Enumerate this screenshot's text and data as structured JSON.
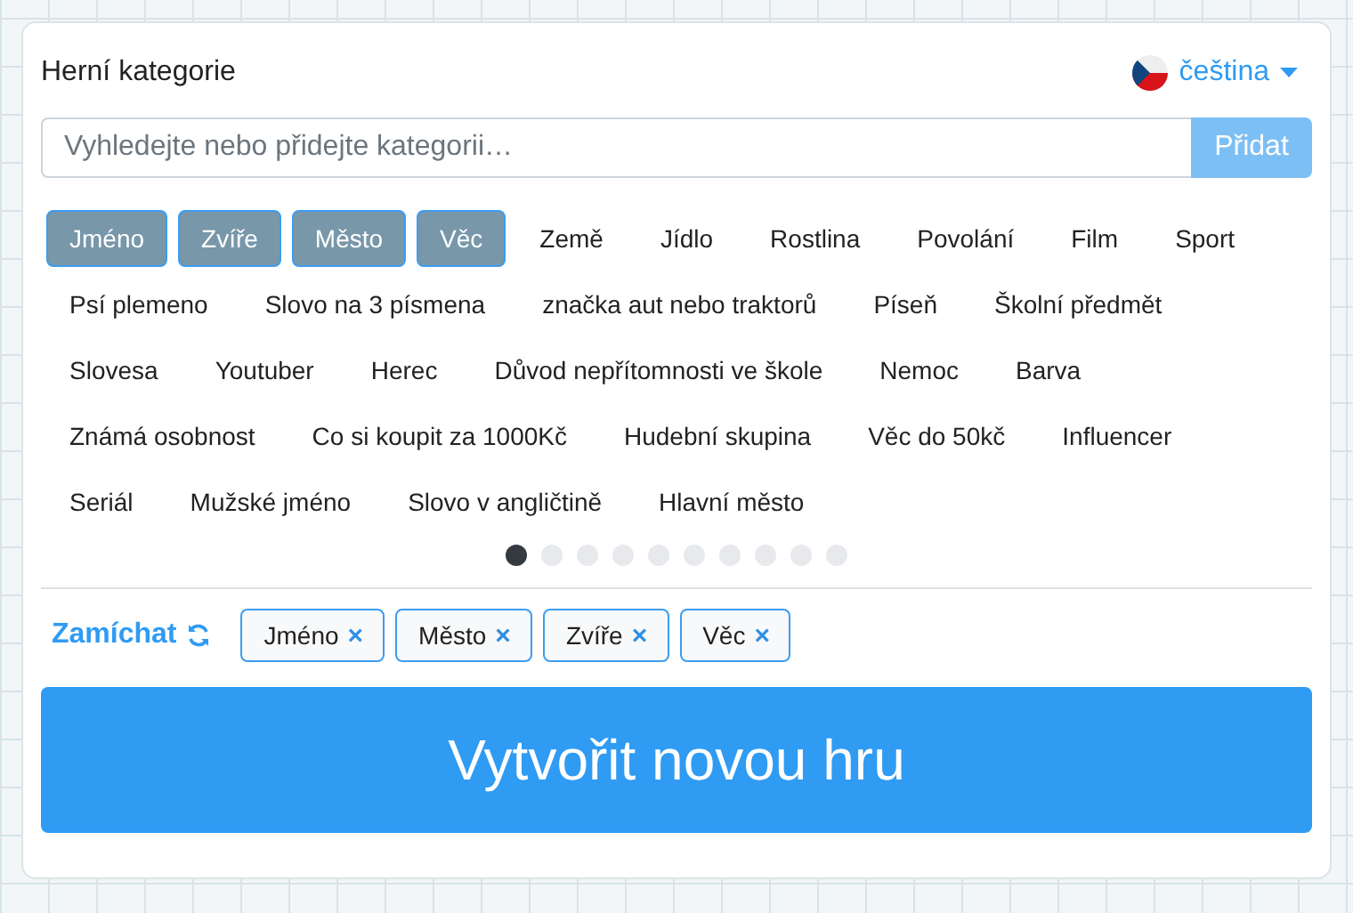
{
  "header": {
    "title": "Herní kategorie",
    "language": "čeština"
  },
  "search": {
    "placeholder": "Vyhledejte nebo přidejte kategorii…",
    "button": "Přidat"
  },
  "categories": [
    {
      "label": "Jméno",
      "selected": true
    },
    {
      "label": "Zvíře",
      "selected": true
    },
    {
      "label": "Město",
      "selected": true
    },
    {
      "label": "Věc",
      "selected": true
    },
    {
      "label": "Země",
      "selected": false
    },
    {
      "label": "Jídlo",
      "selected": false
    },
    {
      "label": "Rostlina",
      "selected": false
    },
    {
      "label": "Povolání",
      "selected": false
    },
    {
      "label": "Film",
      "selected": false
    },
    {
      "label": "Sport",
      "selected": false
    },
    {
      "label": "Psí plemeno",
      "selected": false
    },
    {
      "label": "Slovo na 3 písmena",
      "selected": false
    },
    {
      "label": "značka aut nebo traktorů",
      "selected": false
    },
    {
      "label": "Píseň",
      "selected": false
    },
    {
      "label": "Školní předmět",
      "selected": false
    },
    {
      "label": "Slovesa",
      "selected": false
    },
    {
      "label": "Youtuber",
      "selected": false
    },
    {
      "label": "Herec",
      "selected": false
    },
    {
      "label": "Důvod nepřítomnosti ve škole",
      "selected": false
    },
    {
      "label": "Nemoc",
      "selected": false
    },
    {
      "label": "Barva",
      "selected": false
    },
    {
      "label": "Známá osobnost",
      "selected": false
    },
    {
      "label": "Co si koupit za 1000Kč",
      "selected": false
    },
    {
      "label": "Hudební skupina",
      "selected": false
    },
    {
      "label": "Věc do 50kč",
      "selected": false
    },
    {
      "label": "Influencer",
      "selected": false
    },
    {
      "label": "Seriál",
      "selected": false
    },
    {
      "label": "Mužské jméno",
      "selected": false
    },
    {
      "label": "Slovo v angličtině",
      "selected": false
    },
    {
      "label": "Hlavní město",
      "selected": false
    }
  ],
  "pages": [
    {
      "selected": true
    },
    {
      "selected": false
    },
    {
      "selected": false
    },
    {
      "selected": false
    },
    {
      "selected": false
    },
    {
      "selected": false
    },
    {
      "selected": false
    },
    {
      "selected": false
    },
    {
      "selected": false
    },
    {
      "selected": false
    }
  ],
  "shuffle": "Zamíchat",
  "chosen": [
    {
      "label": "Jméno",
      "remove": "×"
    },
    {
      "label": "Město",
      "remove": "×"
    },
    {
      "label": "Zvíře",
      "remove": "×"
    },
    {
      "label": "Věc",
      "remove": "×"
    }
  ],
  "create_button": "Vytvořit novou hru"
}
